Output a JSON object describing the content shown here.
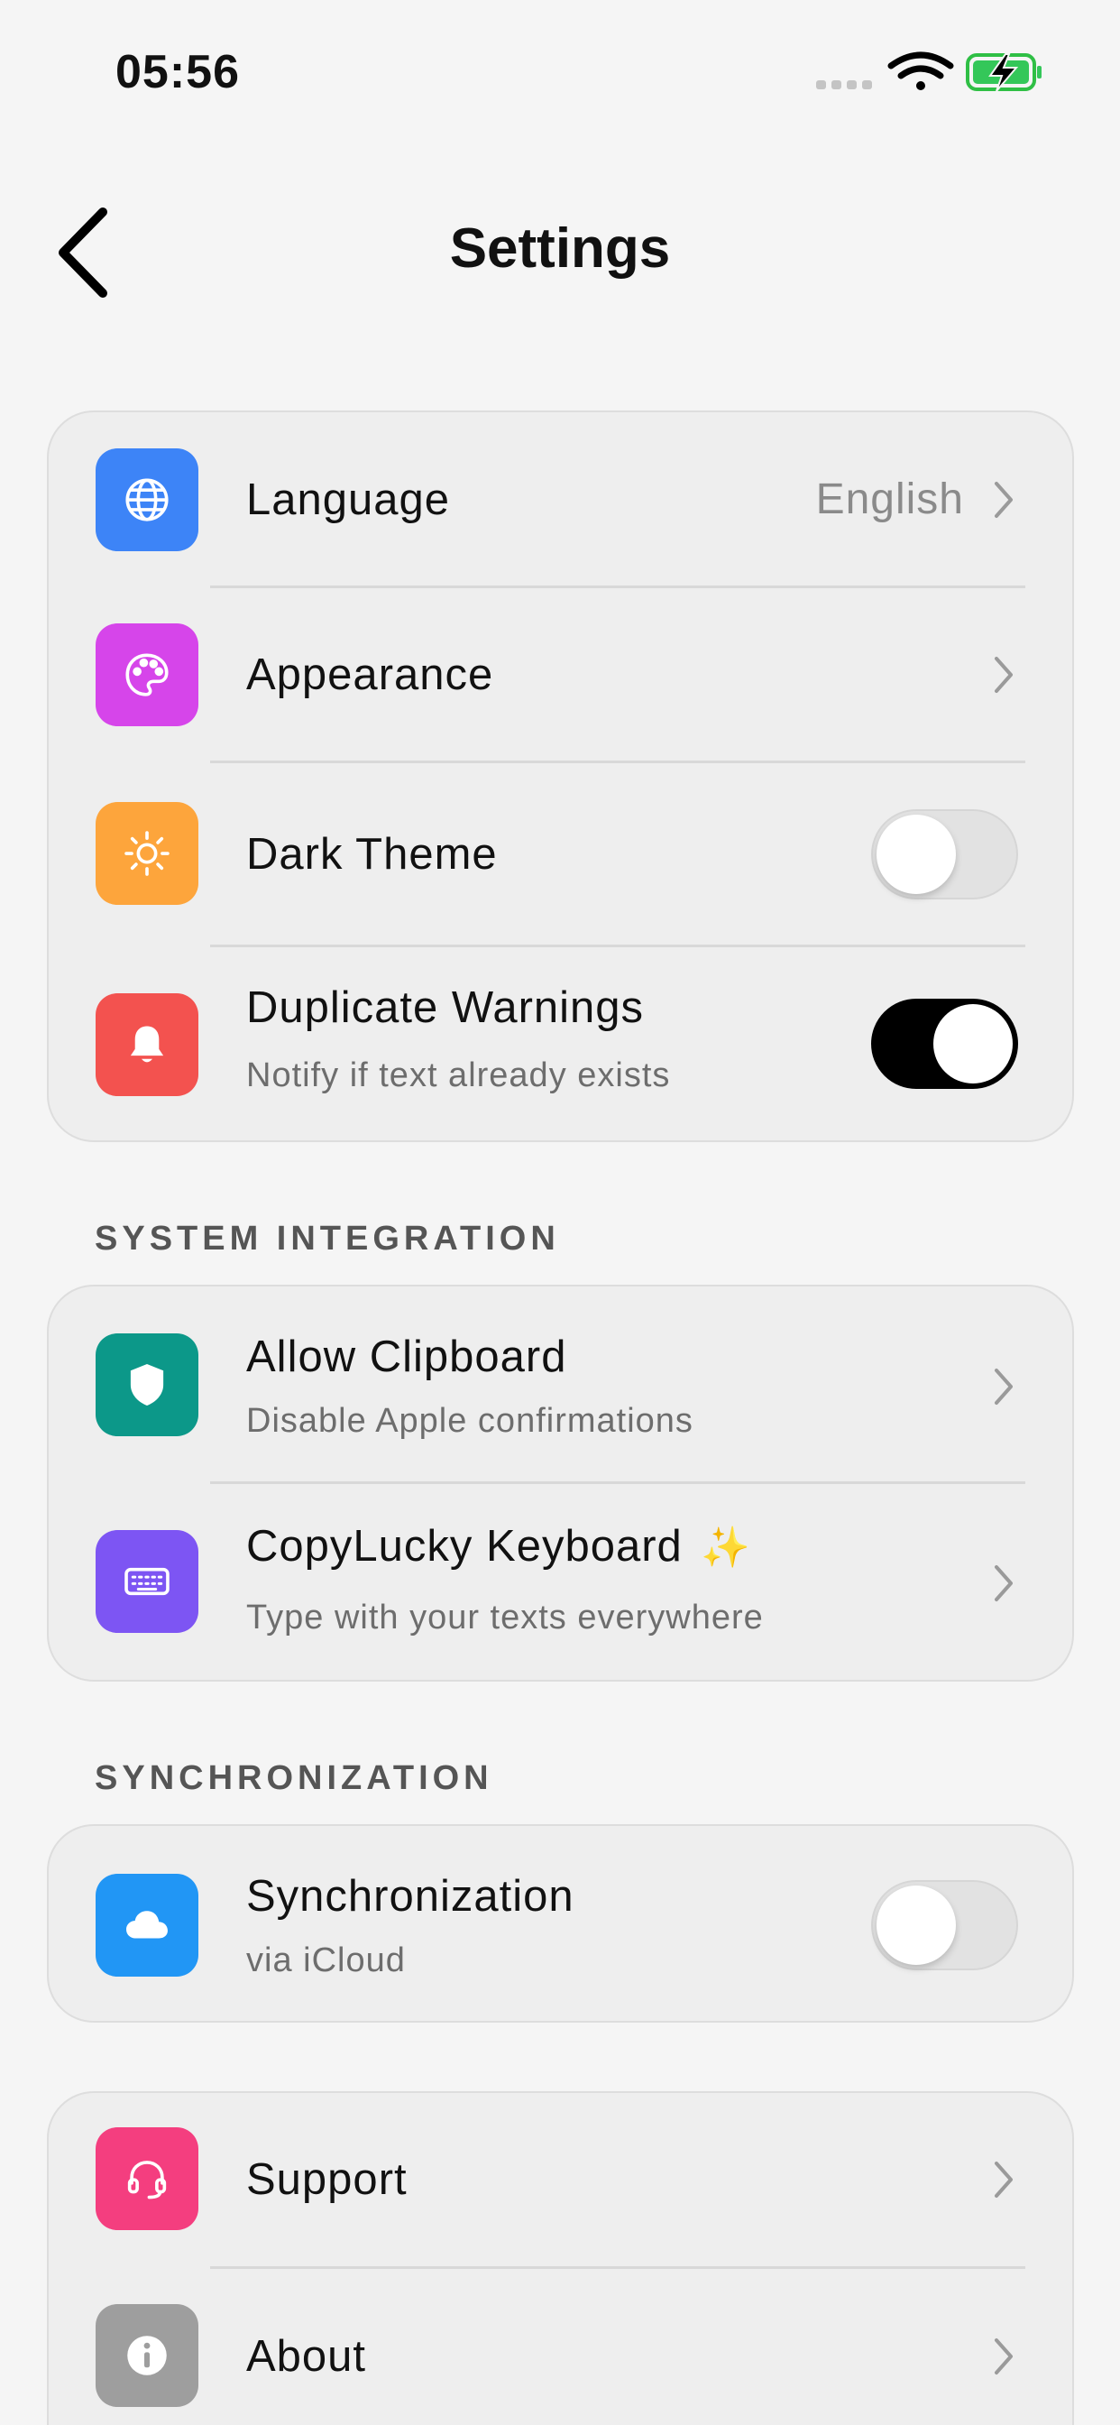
{
  "status_bar": {
    "time": "05:56"
  },
  "nav": {
    "title": "Settings"
  },
  "groups": {
    "general": {
      "language": {
        "label": "Language",
        "value": "English"
      },
      "appearance": {
        "label": "Appearance"
      },
      "dark_theme": {
        "label": "Dark Theme",
        "enabled": false
      },
      "duplicate_warnings": {
        "label": "Duplicate Warnings",
        "subtitle": "Notify if text already exists",
        "enabled": true
      }
    },
    "system_integration": {
      "header": "SYSTEM INTEGRATION",
      "allow_clipboard": {
        "label": "Allow Clipboard",
        "subtitle": "Disable Apple confirmations"
      },
      "keyboard": {
        "label": "CopyLucky Keyboard",
        "badge": "✨",
        "subtitle": "Type with your texts everywhere"
      }
    },
    "synchronization": {
      "header": "SYNCHRONIZATION",
      "sync": {
        "label": "Synchronization",
        "subtitle": "via iCloud",
        "enabled": false
      }
    },
    "info": {
      "support": {
        "label": "Support"
      },
      "about": {
        "label": "About"
      }
    }
  },
  "colors": {
    "language_icon": "#3d84f7",
    "appearance_icon": "#d645ea",
    "dark_theme_icon": "#fda53c",
    "duplicate_icon": "#f3524f",
    "clipboard_icon": "#0c9889",
    "keyboard_icon": "#7d55f3",
    "sync_icon": "#2196f5",
    "support_icon": "#f43e7f",
    "about_icon": "#9e9e9e"
  }
}
